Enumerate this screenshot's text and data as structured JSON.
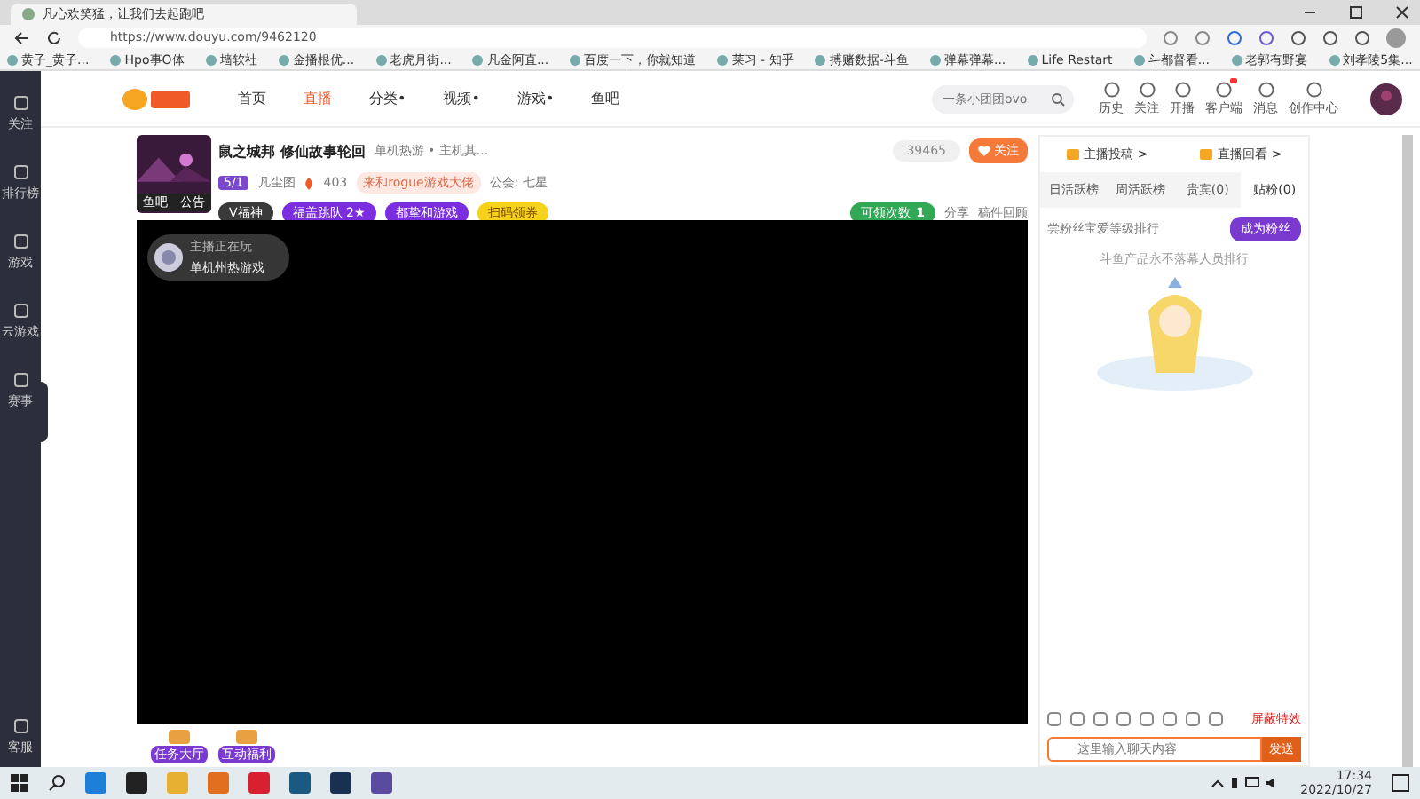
{
  "browser": {
    "tab_title": "凡心欢笑猛，让我们去起跑吧",
    "url": "https://www.douyu.com/9462120",
    "bookmarks": [
      "黄子_黄子...",
      "Hpo事O体",
      "墙软社",
      "金播根优...",
      "老虎月街...",
      "凡金阿直...",
      "百度一下，你就知道",
      "莱习 - 知乎",
      "搏赌数据-斗鱼",
      "弹幕弹幕...",
      "Life Restart",
      "斗都督看...",
      "老郭有野宴",
      "刘孝陵5集..."
    ]
  },
  "header": {
    "nav": [
      {
        "label": "首页",
        "selected": false
      },
      {
        "label": "直播",
        "selected": true
      },
      {
        "label": "分类•",
        "selected": false
      },
      {
        "label": "视频•",
        "selected": false
      },
      {
        "label": "游戏•",
        "selected": false
      },
      {
        "label": "鱼吧",
        "selected": false
      }
    ],
    "search": {
      "placeholder": "一条小团团ovo"
    },
    "tools": [
      {
        "label": "历史",
        "badge": false
      },
      {
        "label": "关注",
        "badge": false
      },
      {
        "label": "开播",
        "badge": false
      },
      {
        "label": "客户端",
        "badge": true
      },
      {
        "label": "消息",
        "badge": false
      },
      {
        "label": "创作中心",
        "badge": false
      }
    ]
  },
  "sidebar": {
    "items": [
      "关注",
      "排行榜",
      "游戏",
      "云游戏",
      "赛事"
    ],
    "footer": "客服"
  },
  "room": {
    "title": "鼠之城邦 修仙故事轮回",
    "category": "单机热游 • 主机其...",
    "level": "5/1",
    "anchor": "凡尘图",
    "hot": "403",
    "tag": "来和rogue游戏大佬",
    "guild": "公会: 七星",
    "cover_labels": [
      "鱼吧",
      "公告"
    ],
    "badges": [
      "V福神",
      "福盖跳队 2★",
      "都挚和游戏",
      "扫码领券"
    ],
    "followers": "39465",
    "follow": "关注",
    "claim": "可领次数",
    "claim_count": "1",
    "share": "分享",
    "replay": "稿件回顾"
  },
  "video": {
    "overlay_title": "主播正在玩",
    "overlay_game": "单机州热游戏"
  },
  "panel": {
    "links": [
      "主播投稿 >",
      "直播回看 >"
    ],
    "tabs": [
      {
        "label": "日活跃榜",
        "selected": false
      },
      {
        "label": "周活跃榜",
        "selected": false
      },
      {
        "label": "贵宾(0)",
        "selected": false
      },
      {
        "label": "贴粉(0)",
        "selected": true
      }
    ],
    "rank_title": "尝粉丝宝爱等级排行",
    "become_fan": "成为粉丝",
    "empty_note": "斗鱼产品永不落幕人员排行",
    "block_effects": "屏蔽特效",
    "chat_placeholder": "这里输入聊天内容",
    "send": "发送"
  },
  "bottom": {
    "items": [
      "任务大厅",
      "互动福利"
    ]
  },
  "taskbar": {
    "time": "17:34",
    "date": "2022/10/27"
  }
}
